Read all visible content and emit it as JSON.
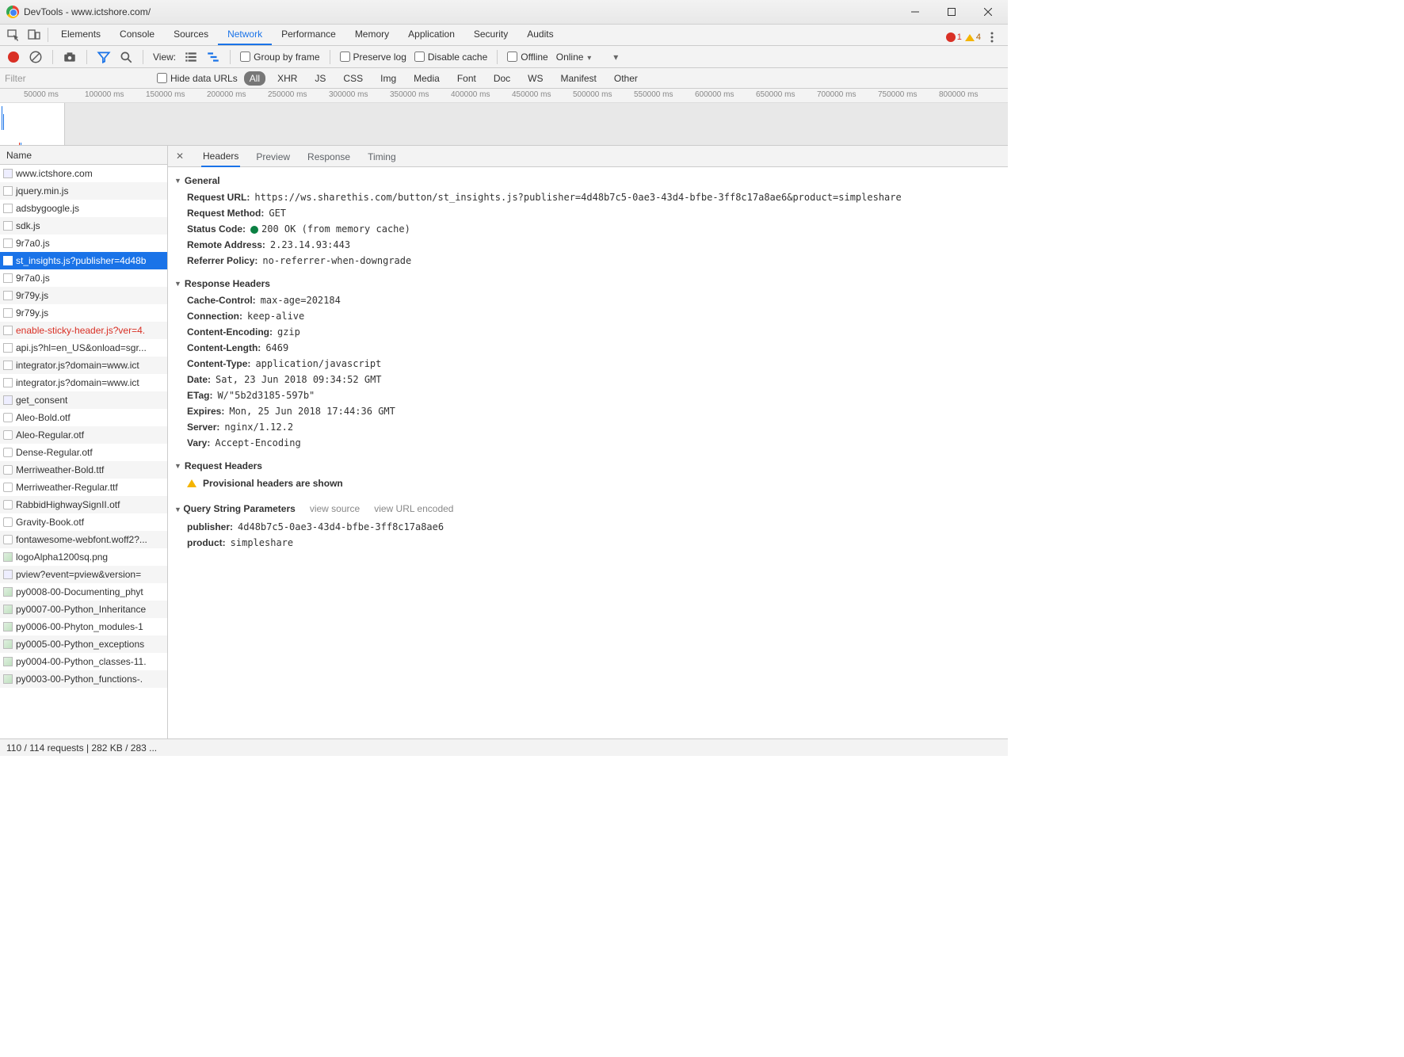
{
  "window": {
    "title": "DevTools - www.ictshore.com/"
  },
  "tabs": {
    "items": [
      "Elements",
      "Console",
      "Sources",
      "Network",
      "Performance",
      "Memory",
      "Application",
      "Security",
      "Audits"
    ],
    "active": "Network",
    "errors": {
      "count": "1"
    },
    "warnings": {
      "count": "4"
    }
  },
  "toolbar": {
    "view_label": "View:",
    "group_by_frame": "Group by frame",
    "preserve_log": "Preserve log",
    "disable_cache": "Disable cache",
    "offline": "Offline",
    "online": "Online"
  },
  "filter": {
    "placeholder": "Filter",
    "hide_data_urls": "Hide data URLs",
    "types": [
      "All",
      "XHR",
      "JS",
      "CSS",
      "Img",
      "Media",
      "Font",
      "Doc",
      "WS",
      "Manifest",
      "Other"
    ],
    "active_type": "All"
  },
  "timeline": {
    "ticks": [
      "50000 ms",
      "100000 ms",
      "150000 ms",
      "200000 ms",
      "250000 ms",
      "300000 ms",
      "350000 ms",
      "400000 ms",
      "450000 ms",
      "500000 ms",
      "550000 ms",
      "600000 ms",
      "650000 ms",
      "700000 ms",
      "750000 ms",
      "800000 ms"
    ]
  },
  "requests": {
    "header": "Name",
    "items": [
      {
        "name": "www.ictshore.com",
        "type": "doc"
      },
      {
        "name": "jquery.min.js",
        "type": "js"
      },
      {
        "name": "adsbygoogle.js",
        "type": "js"
      },
      {
        "name": "sdk.js",
        "type": "js"
      },
      {
        "name": "9r7a0.js",
        "type": "js"
      },
      {
        "name": "st_insights.js?publisher=4d48b",
        "type": "js",
        "selected": true
      },
      {
        "name": "9r7a0.js",
        "type": "js"
      },
      {
        "name": "9r79y.js",
        "type": "js"
      },
      {
        "name": "9r79y.js",
        "type": "js"
      },
      {
        "name": "enable-sticky-header.js?ver=4.",
        "type": "js",
        "error": true
      },
      {
        "name": "api.js?hl=en_US&onload=sgr...",
        "type": "js"
      },
      {
        "name": "integrator.js?domain=www.ict",
        "type": "js"
      },
      {
        "name": "integrator.js?domain=www.ict",
        "type": "js"
      },
      {
        "name": "get_consent",
        "type": "doc"
      },
      {
        "name": "Aleo-Bold.otf",
        "type": "font"
      },
      {
        "name": "Aleo-Regular.otf",
        "type": "font"
      },
      {
        "name": "Dense-Regular.otf",
        "type": "font"
      },
      {
        "name": "Merriweather-Bold.ttf",
        "type": "font"
      },
      {
        "name": "Merriweather-Regular.ttf",
        "type": "font"
      },
      {
        "name": "RabbidHighwaySignII.otf",
        "type": "font"
      },
      {
        "name": "Gravity-Book.otf",
        "type": "font"
      },
      {
        "name": "fontawesome-webfont.woff2?...",
        "type": "font"
      },
      {
        "name": "logoAlpha1200sq.png",
        "type": "img"
      },
      {
        "name": "pview?event=pview&version=",
        "type": "doc"
      },
      {
        "name": "py0008-00-Documenting_phyt",
        "type": "img"
      },
      {
        "name": "py0007-00-Python_Inheritance",
        "type": "img"
      },
      {
        "name": "py0006-00-Phyton_modules-1",
        "type": "img"
      },
      {
        "name": "py0005-00-Python_exceptions",
        "type": "img"
      },
      {
        "name": "py0004-00-Python_classes-11.",
        "type": "img"
      },
      {
        "name": "py0003-00-Python_functions-.",
        "type": "img"
      }
    ]
  },
  "detail": {
    "tabs": [
      "Headers",
      "Preview",
      "Response",
      "Timing"
    ],
    "active": "Headers",
    "general": {
      "title": "General",
      "request_url_key": "Request URL:",
      "request_url_val": "https://ws.sharethis.com/button/st_insights.js?publisher=4d48b7c5-0ae3-43d4-bfbe-3ff8c17a8ae6&product=simpleshare",
      "request_method_key": "Request Method:",
      "request_method_val": "GET",
      "status_code_key": "Status Code:",
      "status_code_val": "200 OK (from memory cache)",
      "remote_address_key": "Remote Address:",
      "remote_address_val": "2.23.14.93:443",
      "referrer_policy_key": "Referrer Policy:",
      "referrer_policy_val": "no-referrer-when-downgrade"
    },
    "response_headers": {
      "title": "Response Headers",
      "rows": [
        {
          "k": "Cache-Control:",
          "v": "max-age=202184"
        },
        {
          "k": "Connection:",
          "v": "keep-alive"
        },
        {
          "k": "Content-Encoding:",
          "v": "gzip"
        },
        {
          "k": "Content-Length:",
          "v": "6469"
        },
        {
          "k": "Content-Type:",
          "v": "application/javascript"
        },
        {
          "k": "Date:",
          "v": "Sat, 23 Jun 2018 09:34:52 GMT"
        },
        {
          "k": "ETag:",
          "v": "W/\"5b2d3185-597b\""
        },
        {
          "k": "Expires:",
          "v": "Mon, 25 Jun 2018 17:44:36 GMT"
        },
        {
          "k": "Server:",
          "v": "nginx/1.12.2"
        },
        {
          "k": "Vary:",
          "v": "Accept-Encoding"
        }
      ]
    },
    "request_headers": {
      "title": "Request Headers",
      "provisional": "Provisional headers are shown"
    },
    "query": {
      "title": "Query String Parameters",
      "view_source": "view source",
      "view_url": "view URL encoded",
      "rows": [
        {
          "k": "publisher:",
          "v": "4d48b7c5-0ae3-43d4-bfbe-3ff8c17a8ae6"
        },
        {
          "k": "product:",
          "v": "simpleshare"
        }
      ]
    }
  },
  "status": {
    "text": "110 / 114 requests  |  282 KB / 283 ..."
  }
}
